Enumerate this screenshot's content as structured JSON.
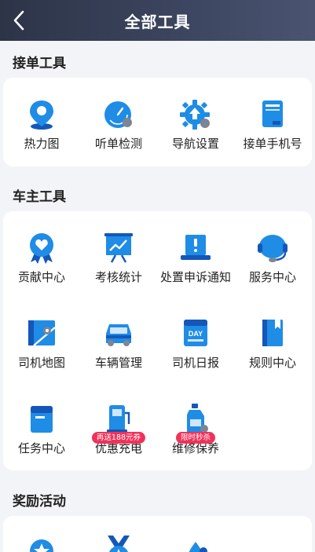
{
  "header": {
    "title": "全部工具"
  },
  "sections": [
    {
      "title": "接单工具",
      "tools": [
        {
          "label": "热力图",
          "icon": "heatmap-pin-icon"
        },
        {
          "label": "听单检测",
          "icon": "speed-gauge-icon"
        },
        {
          "label": "导航设置",
          "icon": "gear-upload-icon"
        },
        {
          "label": "接单手机号",
          "icon": "phone-card-icon"
        }
      ]
    },
    {
      "title": "车主工具",
      "tools": [
        {
          "label": "贡献中心",
          "icon": "heart-badge-icon"
        },
        {
          "label": "考核统计",
          "icon": "chart-board-icon"
        },
        {
          "label": "处置申诉通知",
          "icon": "laptop-alert-icon"
        },
        {
          "label": "服务中心",
          "icon": "headset-icon"
        },
        {
          "label": "司机地图",
          "icon": "map-icon"
        },
        {
          "label": "车辆管理",
          "icon": "car-icon"
        },
        {
          "label": "司机日报",
          "icon": "daily-calendar-icon"
        },
        {
          "label": "规则中心",
          "icon": "rule-book-icon"
        },
        {
          "label": "任务中心",
          "icon": "task-box-icon"
        },
        {
          "label": "优惠充电",
          "icon": "charging-station-icon",
          "tag": "再送188元券"
        },
        {
          "label": "维修保养",
          "icon": "oil-bottle-icon",
          "tag": "限时秒杀"
        }
      ]
    },
    {
      "title": "奖励活动",
      "tools": [
        {
          "label": "",
          "icon": "star-medal-icon"
        },
        {
          "label": "",
          "icon": "ribbon-medal-icon"
        },
        {
          "label": "",
          "icon": "drop-icon"
        }
      ]
    }
  ],
  "colors": {
    "primary_blue": "#1f8ce6",
    "dark_blue": "#1457b8",
    "accent_gray": "#7d8594",
    "tag_red": "#f0325a"
  }
}
